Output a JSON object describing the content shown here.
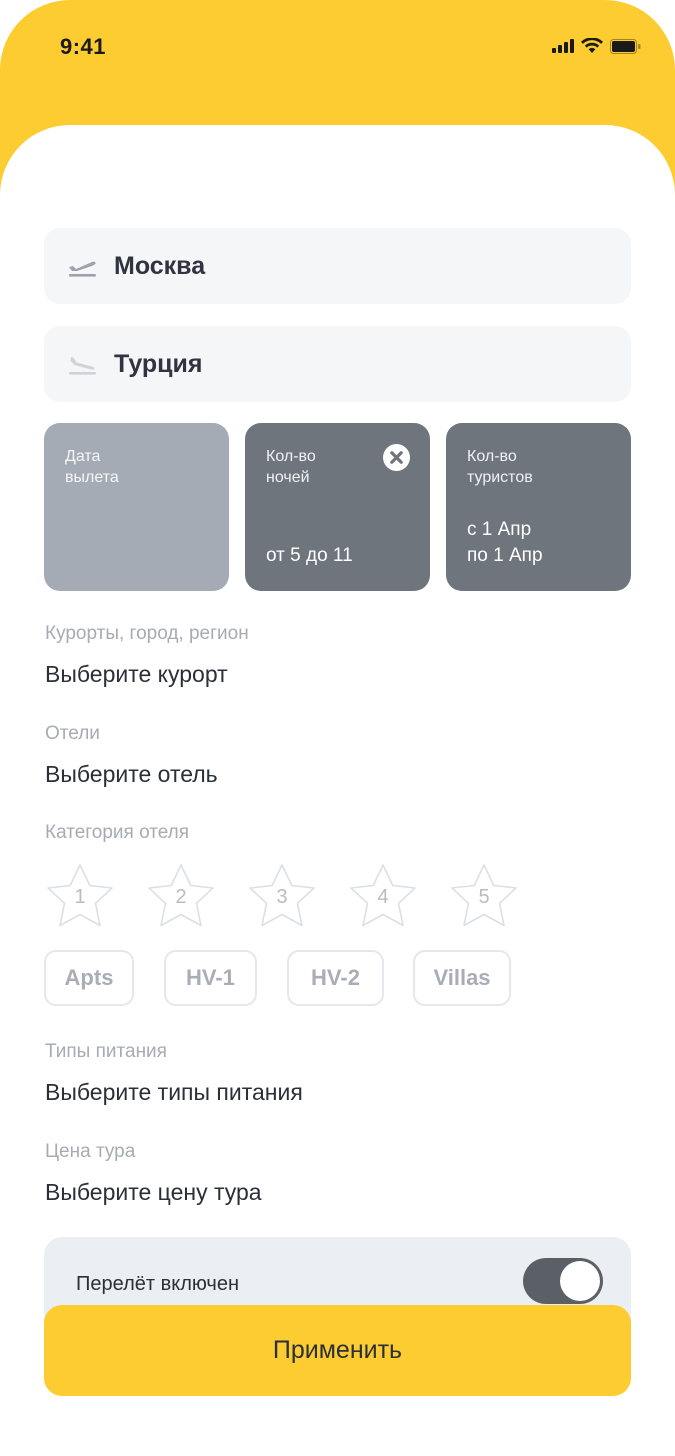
{
  "status_bar": {
    "time": "9:41",
    "signal_icon": "signal-bars-icon",
    "wifi_icon": "wifi-icon",
    "battery_icon": "battery-icon"
  },
  "search": {
    "from": {
      "value": "Москва",
      "icon": "plane-takeoff-icon"
    },
    "to": {
      "value": "Турция",
      "icon": "plane-landing-icon"
    }
  },
  "cards": {
    "date": {
      "label_line1": "Дата",
      "label_line2": "вылета",
      "value": ""
    },
    "nights": {
      "label_line1": "Кол-во",
      "label_line2": "ночей",
      "value": "от 5 до 11",
      "clear_icon": "close-circle-icon"
    },
    "tourists": {
      "label_line1": "Кол-во",
      "label_line2": "туристов",
      "value_line1": "с 1 Апр",
      "value_line2": "по 1 Апр"
    }
  },
  "filters": {
    "resort": {
      "label": "Курорты, город, регион",
      "value": "Выберите курорт"
    },
    "hotel": {
      "label": "Отели",
      "value": "Выберите отель"
    },
    "category": {
      "label": "Категория отеля",
      "stars": [
        "1",
        "2",
        "3",
        "4",
        "5"
      ],
      "chips": [
        "Apts",
        "HV-1",
        "HV-2",
        "Villas"
      ]
    },
    "meal": {
      "label": "Типы питания",
      "value": "Выберите типы питания"
    },
    "price": {
      "label": "Цена тура",
      "value": "Выберите цену тура"
    }
  },
  "flight_toggle": {
    "label": "Перелёт включен",
    "enabled": true
  },
  "apply_button": {
    "label": "Применить"
  },
  "colors": {
    "accent": "#FDCC31",
    "card_light": "#A4ABB4",
    "card_dark": "#6F757D",
    "toggle_on": "#5B6067"
  }
}
